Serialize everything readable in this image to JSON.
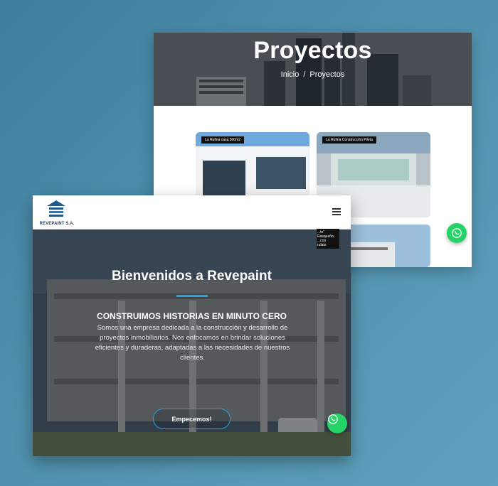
{
  "back_window": {
    "title": "Proyectos",
    "breadcrumb": {
      "home": "Inicio",
      "separator": "/",
      "current": "Proyectos"
    },
    "projects": [
      {
        "label": "La Rufina casa 500m2"
      },
      {
        "label": "La Rufina Construcción Pileta"
      },
      {
        "label": "...to\" Rasqueño, ...con rulato"
      }
    ],
    "whatsapp_icon": "whatsapp-icon"
  },
  "front_window": {
    "brand": {
      "name": "REVEPAINT S.A.",
      "icon": "building-logo-icon"
    },
    "menu_icon": "hamburger-menu-icon",
    "hero": {
      "title": "Bienvenidos a Revepaint",
      "subtitle": "CONSTRUIMOS HISTORIAS EN MINUTO CERO",
      "description": "Somos una empresa dedicada a la construcción y desarrollo de proyectos inmobiliarios. Nos enfocamos en brindar soluciones eficientes y duraderas, adaptadas a las necesidades de nuestros clientes.",
      "cta_label": "Empecemos!"
    },
    "whatsapp_icon": "whatsapp-icon",
    "accent_color": "#1fa4e0",
    "whatsapp_color": "#25d366"
  }
}
